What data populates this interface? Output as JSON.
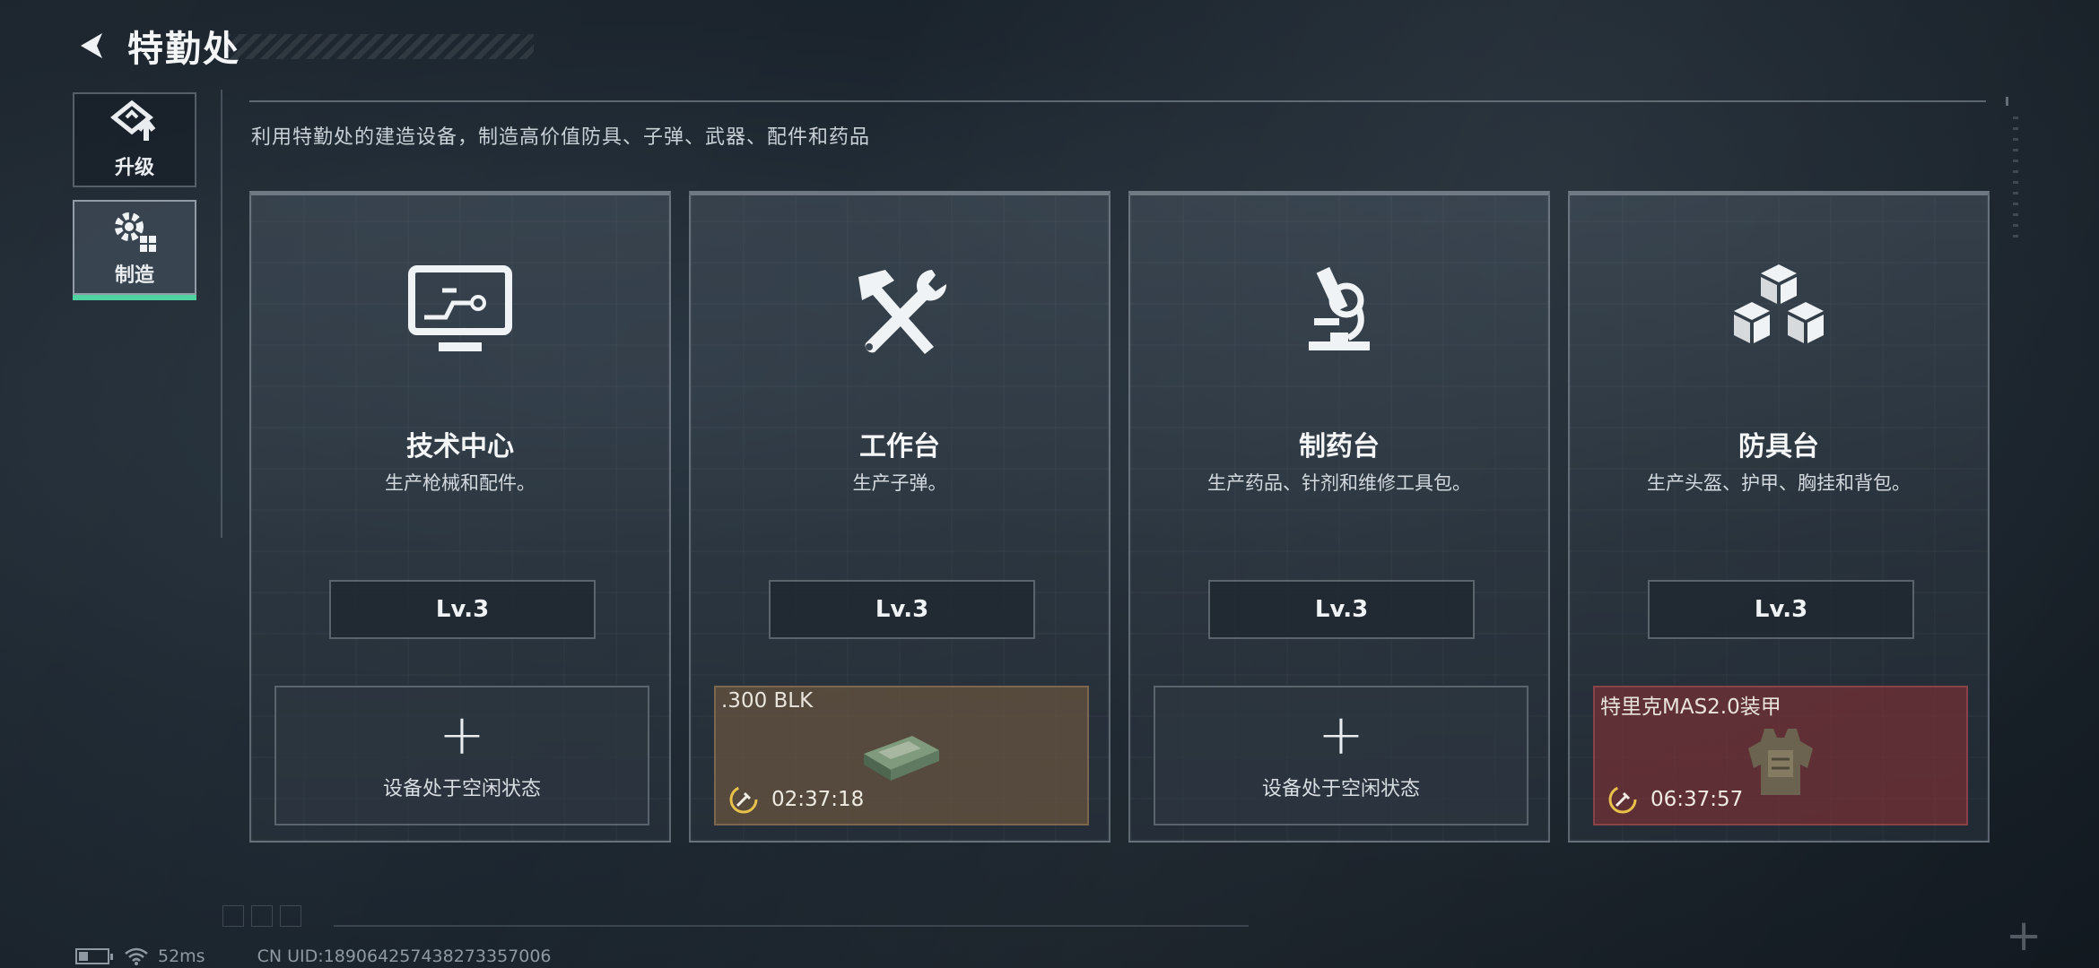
{
  "header": {
    "title": "特勤处"
  },
  "side_nav": [
    {
      "label": "升级",
      "icon": "upgrade-icon",
      "active": false
    },
    {
      "label": "制造",
      "icon": "craft-gear-icon",
      "active": true
    }
  ],
  "subtitle": "利用特勤处的建造设备，制造高价值防具、子弹、武器、配件和药品",
  "cards": [
    {
      "title": "技术中心",
      "desc": "生产枪械和配件。",
      "level": "Lv.3",
      "icon": "monitor-icon",
      "slot": {
        "state": "idle",
        "plus": "+",
        "text": "设备处于空闲状态"
      }
    },
    {
      "title": "工作台",
      "desc": "生产子弹。",
      "level": "Lv.3",
      "icon": "hammer-wrench-icon",
      "slot": {
        "state": "busy",
        "item": ".300 BLK",
        "timer": "02:37:18",
        "color": "#695640"
      }
    },
    {
      "title": "制药台",
      "desc": "生产药品、针剂和维修工具包。",
      "level": "Lv.3",
      "icon": "microscope-icon",
      "slot": {
        "state": "idle",
        "plus": "+",
        "text": "设备处于空闲状态"
      }
    },
    {
      "title": "防具台",
      "desc": "生产头盔、护甲、胸挂和背包。",
      "level": "Lv.3",
      "icon": "cubes-icon",
      "slot": {
        "state": "busy",
        "item": "特里克MAS2.0装甲",
        "timer": "06:37:57",
        "color": "#783034"
      }
    }
  ],
  "footer": {
    "ping": "52ms",
    "uid": "CN UID:1890642574382733570​06"
  },
  "colors": {
    "accent": "#4fd2a0"
  }
}
